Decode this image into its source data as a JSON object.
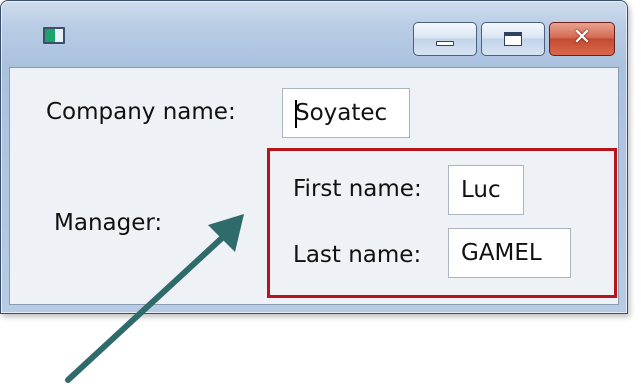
{
  "window": {
    "title": "",
    "icon": "app-window-icon",
    "controls": {
      "minimize": "minimize-icon",
      "maximize": "maximize-icon",
      "close_glyph": "✕"
    }
  },
  "form": {
    "company": {
      "label": "Company name:",
      "value": "Soyatec"
    },
    "manager": {
      "label": "Manager:",
      "first_name_label": "First name:",
      "first_name_value": "Luc",
      "last_name_label": "Last name:",
      "last_name_value": "GAMEL"
    }
  },
  "annotation": {
    "highlight_color": "#b8141c",
    "arrow_color": "#2f6b6a"
  }
}
